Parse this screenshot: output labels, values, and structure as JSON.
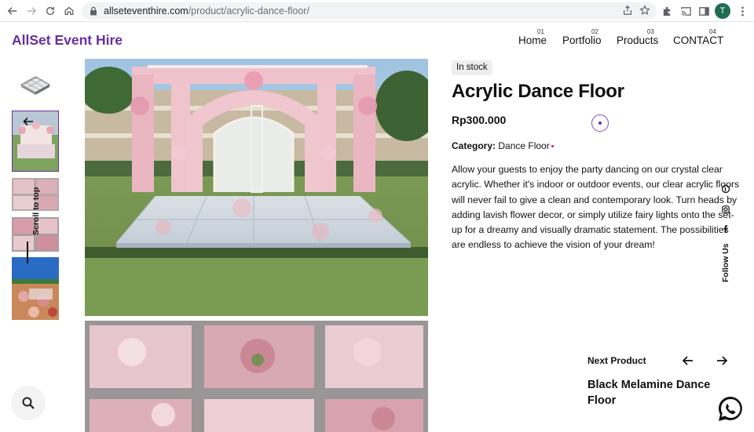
{
  "browser": {
    "url_host": "allseteventhire.com",
    "url_path": "/product/acrylic-dance-floor/",
    "profile_initial": "T"
  },
  "header": {
    "logo": "AllSet Event Hire",
    "nav": [
      {
        "num": "01",
        "label": "Home"
      },
      {
        "num": "02",
        "label": "Portfolio"
      },
      {
        "num": "03",
        "label": "Products"
      },
      {
        "num": "04",
        "label": "CONTACT"
      }
    ]
  },
  "gallery": {
    "scroll_to_top": "Scroll to top"
  },
  "product": {
    "stock": "In stock",
    "title": "Acrylic Dance Floor",
    "price": "Rp300.000",
    "category_label": "Category:",
    "category": "Dance Floor",
    "description": "Allow your guests to enjoy the party dancing on our crystal clear acrylic. Whether it's indoor or outdoor events, our clear acrylic floors will never fail to give a clean and contemporary look. Turn heads by adding lavish flower decor, or simply utilize fairy lights onto the set-up for a dreamy and visually dramatic statement. The possibilities are endless to achieve the vision of your dream!"
  },
  "social": {
    "follow_label": "Follow Us",
    "icons": [
      "pinterest-icon",
      "instagram-icon",
      "facebook-icon"
    ]
  },
  "next_product": {
    "label": "Next Product",
    "title": "Black Melamine Dance Floor"
  },
  "colors": {
    "brand": "#6a2ea0",
    "accent_dot": "#d0203a",
    "whatsapp": "#111111"
  }
}
